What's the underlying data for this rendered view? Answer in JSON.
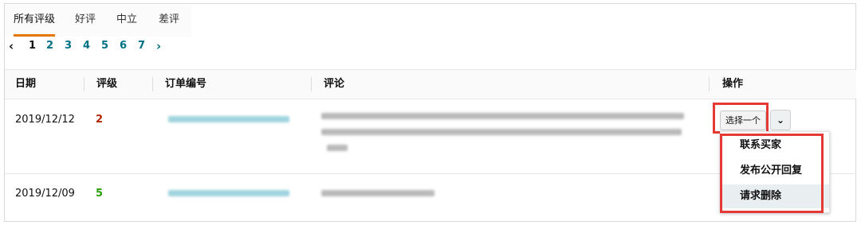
{
  "tabs": [
    {
      "label": "所有评级",
      "active": true
    },
    {
      "label": "好评",
      "active": false
    },
    {
      "label": "中立",
      "active": false
    },
    {
      "label": "差评",
      "active": false
    }
  ],
  "pagination": {
    "prev_icon": "‹",
    "next_icon": "›",
    "pages": [
      "1",
      "2",
      "3",
      "4",
      "5",
      "6",
      "7"
    ],
    "current": "1"
  },
  "table": {
    "headers": {
      "date": "日期",
      "rating": "评级",
      "order_id": "订单编号",
      "comment": "评论",
      "actions": "操作"
    },
    "rows": [
      {
        "date": "2019/12/12",
        "rating": "2"
      },
      {
        "date": "2019/12/09",
        "rating": "5"
      }
    ]
  },
  "actions": {
    "select_label": "选择一个",
    "chevron_icon": "⌄",
    "menu": [
      "联系买家",
      "发布公开回复",
      "请求删除"
    ]
  },
  "colors": {
    "link": "#007185",
    "accent_tab": "#e77600",
    "rating_bad": "#b12704",
    "rating_good": "#2a9d0d",
    "highlight": "#e53935"
  }
}
